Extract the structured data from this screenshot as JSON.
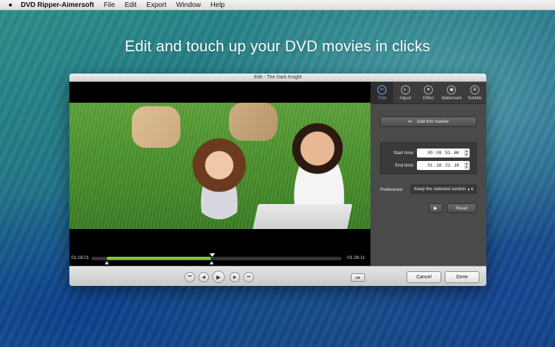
{
  "menubar": {
    "app_name": "DVD Ripper-Aimersoft",
    "items": [
      "File",
      "Edit",
      "Export",
      "Window",
      "Help"
    ]
  },
  "headline": "Edit and touch up your DVD movies in clicks",
  "window": {
    "title": "Edit - The Dark Knight",
    "player": {
      "current_time": "01:18:21",
      "remaining_time": "-01:26:11"
    },
    "tabs": [
      {
        "label": "Trim",
        "icon": "scissors-icon",
        "glyph": "✂",
        "active": true
      },
      {
        "label": "Adjust",
        "icon": "adjust-icon",
        "glyph": "◐",
        "active": false
      },
      {
        "label": "Effect",
        "icon": "effect-icon",
        "glyph": "✦",
        "active": false
      },
      {
        "label": "Watermark",
        "icon": "watermark-icon",
        "glyph": "◉",
        "active": false
      },
      {
        "label": "Subtitle",
        "icon": "subtitle-icon",
        "glyph": "A",
        "active": false
      }
    ],
    "trim": {
      "add_marker_label": "Add trim marker",
      "start_label": "Start time:",
      "start_value": "00 : 09 : 51 . 88",
      "end_label": "End time:",
      "end_value": "01 : 18 : 21 . 18",
      "preference_label": "Preference:",
      "preference_value": "Keep the selected section",
      "reset_label": "Reset"
    },
    "footer": {
      "cancel_label": "Cancel",
      "done_label": "Done"
    }
  },
  "colors": {
    "accent": "#7fb3ff",
    "selection_green": "#7ec036"
  }
}
